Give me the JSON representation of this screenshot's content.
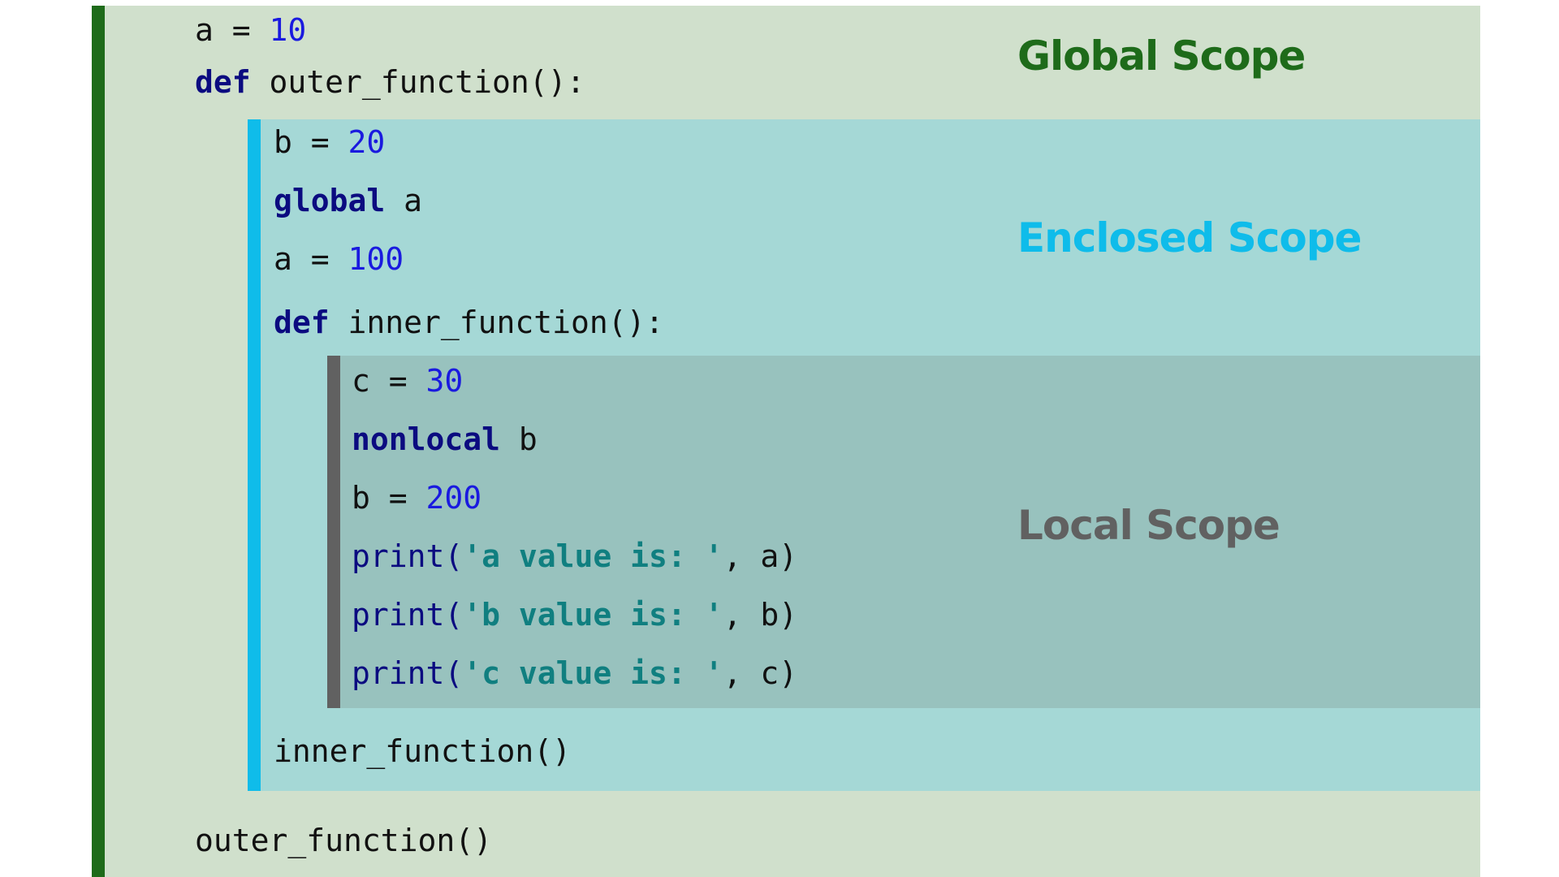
{
  "scopes": {
    "global": {
      "label": "Global Scope",
      "color": "#1e6b1a"
    },
    "enclosed": {
      "label": "Enclosed Scope",
      "color": "#0fbcea"
    },
    "local": {
      "label": "Local Scope",
      "color": "#616161"
    }
  },
  "code": {
    "global_assign": {
      "var": "a",
      "op": " = ",
      "value": "10"
    },
    "outer_def": {
      "kw": "def",
      "sig": " outer_function():"
    },
    "enclosed_assign_b": {
      "var": "b",
      "op": " = ",
      "value": "20"
    },
    "global_stmt": {
      "kw": "global",
      "name": " a"
    },
    "enclosed_assign_a": {
      "var": "a",
      "op": " = ",
      "value": "100"
    },
    "inner_def": {
      "kw": "def",
      "sig": " inner_function():"
    },
    "local_assign_c": {
      "var": "c",
      "op": " = ",
      "value": "30"
    },
    "nonlocal_stmt": {
      "kw": "nonlocal",
      "name": " b"
    },
    "local_assign_b": {
      "var": "b",
      "op": " = ",
      "value": "200"
    },
    "print_a": {
      "fn": "print(",
      "str": "'a value is: '",
      "rest": ", a)"
    },
    "print_b": {
      "fn": "print(",
      "str": "'b value is: '",
      "rest": ", b)"
    },
    "print_c": {
      "fn": "print(",
      "str": "'c value is: '",
      "rest": ", c)"
    },
    "inner_call": "inner_function()",
    "outer_call": "outer_function()"
  }
}
